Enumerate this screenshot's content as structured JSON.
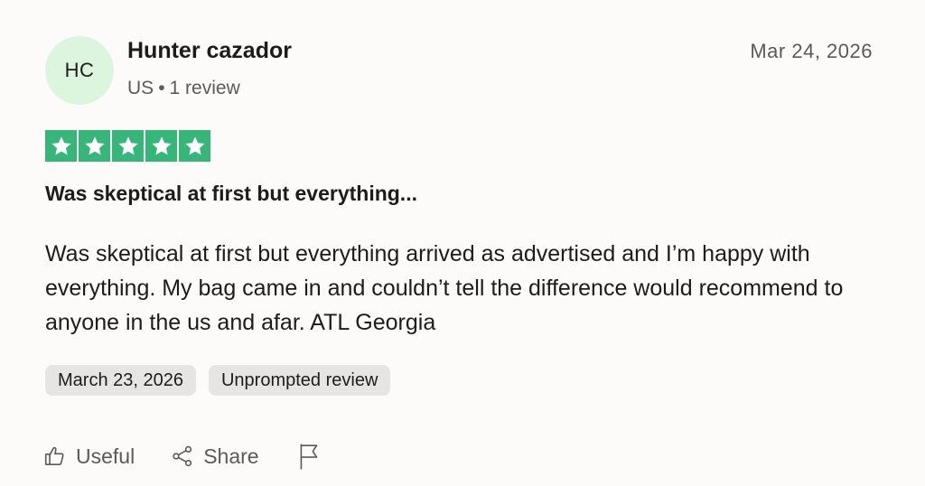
{
  "reviewer": {
    "initials": "HC",
    "name": "Hunter cazador",
    "country": "US",
    "separator": "•",
    "review_count": "1 review",
    "avatar_color": "#dcf5df"
  },
  "review": {
    "date": "Mar 24, 2026",
    "rating": 5,
    "star_color": "#37b67a",
    "title": "Was skeptical at first but everything...",
    "body": "Was skeptical at first but everything arrived as advertised and I’m happy with everything. My bag came in and couldn’t tell the difference would recommend to anyone in the us and afar. ATL Georgia",
    "tags": {
      "experience_date": "March 23, 2026",
      "type": "Unprompted review"
    }
  },
  "actions": {
    "useful_label": "Useful",
    "share_label": "Share",
    "useful_icon": "thumbs-up-icon",
    "share_icon": "share-icon",
    "report_icon": "flag-icon"
  }
}
